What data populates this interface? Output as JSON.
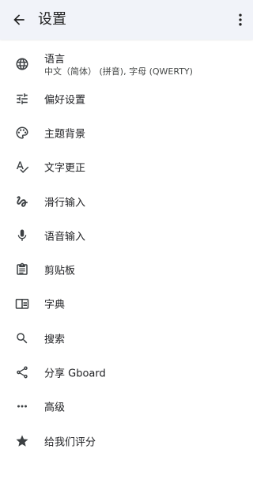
{
  "appbar": {
    "title": "设置",
    "back_icon": "arrow-back-icon",
    "more_icon": "more-vert-icon"
  },
  "settings": {
    "items": [
      {
        "label": "语言",
        "sublabel": "中文（简体） (拼音), 字母 (QWERTY)",
        "icon": "globe-icon"
      },
      {
        "label": "偏好设置",
        "icon": "tune-icon"
      },
      {
        "label": "主题背景",
        "icon": "palette-icon"
      },
      {
        "label": "文字更正",
        "icon": "spellcheck-icon"
      },
      {
        "label": "滑行输入",
        "icon": "gesture-icon"
      },
      {
        "label": "语音输入",
        "icon": "mic-icon"
      },
      {
        "label": "剪贴板",
        "icon": "clipboard-icon"
      },
      {
        "label": "字典",
        "icon": "book-icon"
      },
      {
        "label": "搜索",
        "icon": "search-icon"
      },
      {
        "label": "分享 Gboard",
        "icon": "share-icon"
      },
      {
        "label": "高级",
        "icon": "more-horiz-icon"
      },
      {
        "label": "给我们评分",
        "icon": "star-icon"
      }
    ]
  },
  "colors": {
    "appbar_bg": "#f1f3f9",
    "icon": "#3c4043",
    "text": "#202124",
    "subtext": "#444746"
  }
}
